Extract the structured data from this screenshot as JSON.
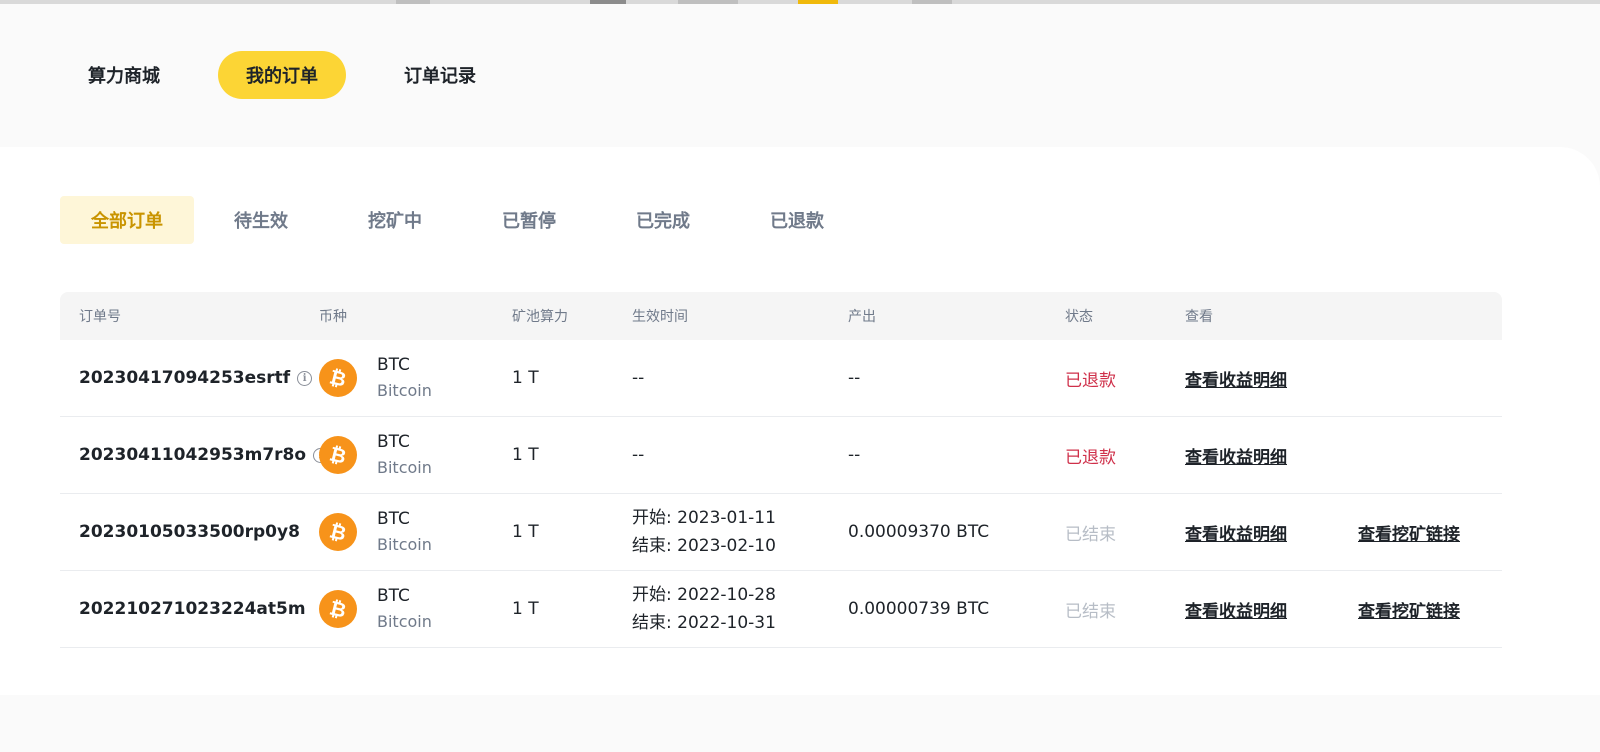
{
  "top_tabs": [
    {
      "label": "算力商城",
      "active": false
    },
    {
      "label": "我的订单",
      "active": true
    },
    {
      "label": "订单记录",
      "active": false
    }
  ],
  "filter_tabs": [
    {
      "label": "全部订单",
      "active": true
    },
    {
      "label": "待生效",
      "active": false
    },
    {
      "label": "挖矿中",
      "active": false
    },
    {
      "label": "已暂停",
      "active": false
    },
    {
      "label": "已完成",
      "active": false
    },
    {
      "label": "已退款",
      "active": false
    }
  ],
  "table": {
    "headers": {
      "order_id": "订单号",
      "coin": "币种",
      "pool_power": "矿池算力",
      "effective_time": "生效时间",
      "output": "产出",
      "status": "状态",
      "view": "查看"
    },
    "rows": [
      {
        "order_id": "20230417094253esrtf",
        "has_info": true,
        "coin_symbol": "BTC",
        "coin_name": "Bitcoin",
        "power": "1 T",
        "time_single": "--",
        "time_start": "",
        "time_end": "",
        "output": "--",
        "status": "已退款",
        "status_type": "refunded",
        "view_link": "查看收益明细",
        "mining_link": ""
      },
      {
        "order_id": "20230411042953m7r8o",
        "has_info": true,
        "coin_symbol": "BTC",
        "coin_name": "Bitcoin",
        "power": "1 T",
        "time_single": "--",
        "time_start": "",
        "time_end": "",
        "output": "--",
        "status": "已退款",
        "status_type": "refunded",
        "view_link": "查看收益明细",
        "mining_link": ""
      },
      {
        "order_id": "20230105033500rp0y8",
        "has_info": false,
        "coin_symbol": "BTC",
        "coin_name": "Bitcoin",
        "power": "1 T",
        "time_single": "",
        "time_start": "开始: 2023-01-11",
        "time_end": "结束: 2023-02-10",
        "output": "0.00009370 BTC",
        "status": "已结束",
        "status_type": "ended",
        "view_link": "查看收益明细",
        "mining_link": "查看挖矿链接"
      },
      {
        "order_id": "202210271023224at5m",
        "has_info": false,
        "coin_symbol": "BTC",
        "coin_name": "Bitcoin",
        "power": "1 T",
        "time_single": "",
        "time_start": "开始: 2022-10-28",
        "time_end": "结束: 2022-10-31",
        "output": "0.00000739 BTC",
        "status": "已结束",
        "status_type": "ended",
        "view_link": "查看收益明细",
        "mining_link": "查看挖矿链接"
      }
    ]
  },
  "icons": {
    "coin": "bitcoin-icon",
    "info": "info-icon"
  },
  "colors": {
    "accent_yellow": "#fcd535",
    "active_filter_bg": "#fef6d8",
    "active_filter_text": "#c99400",
    "refunded": "#cf304a",
    "ended": "#b7bdc6",
    "btc_orange": "#f7931a"
  }
}
